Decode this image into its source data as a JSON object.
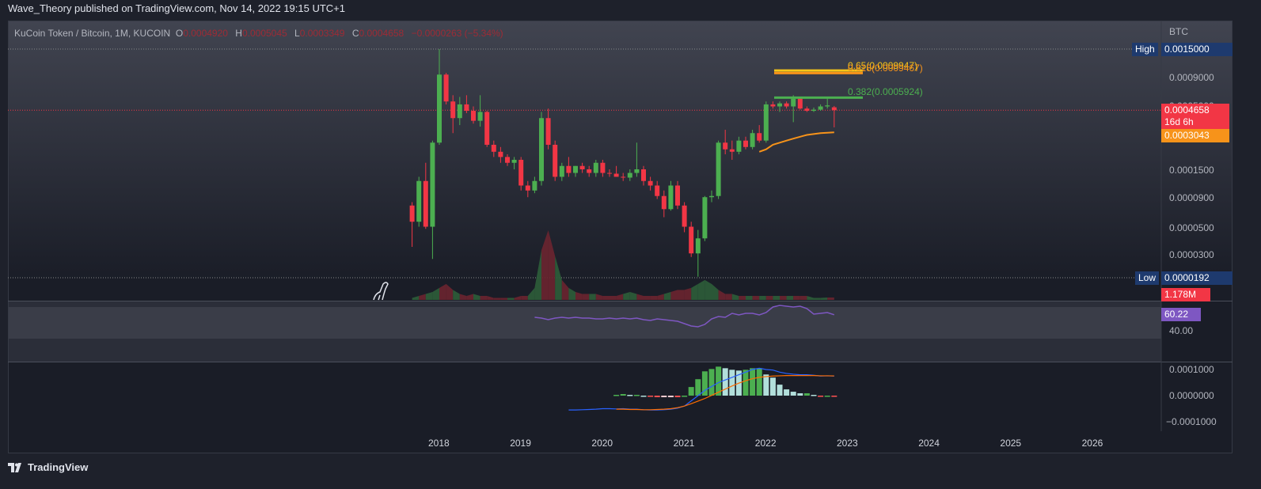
{
  "header": {
    "publisher_line": "Wave_Theory published on TradingView.com, Nov 14, 2022 19:15 UTC+1"
  },
  "legend": {
    "symbol": "KuCoin Token / Bitcoin, 1M, KUCOIN",
    "o_label": "O",
    "o": "0.0004920",
    "h_label": "H",
    "h": "0.0005045",
    "l_label": "L",
    "l": "0.0003349",
    "c_label": "C",
    "c": "0.0004658",
    "change": "−0.0000263 (−5.34%)"
  },
  "price_axis": {
    "currency": "BTC",
    "ticks": [
      "0.0009000",
      "0.0005000",
      "0.0001500",
      "0.0000900",
      "0.0000500",
      "0.0000300"
    ],
    "high_label": "High",
    "high_value": "0.0015000",
    "low_label": "Low",
    "low_value": "0.0000192",
    "last_price": "0.0004658",
    "countdown": "16d 6h",
    "ema_value": "0.0003043",
    "volume_value": "1.178M"
  },
  "rsi": {
    "value_label": "60.22",
    "tick": "40.00"
  },
  "macd": {
    "ticks": [
      "0.0001000",
      "0.0000000",
      "−0.0001000"
    ]
  },
  "time_axis": {
    "ticks": [
      "2018",
      "2019",
      "2020",
      "2021",
      "2022",
      "2023",
      "2024",
      "2025",
      "2026"
    ]
  },
  "fib": [
    {
      "label": "0.65(0.0009947)",
      "price": 0.0009947,
      "color": "#f5c518"
    },
    {
      "label": "0.618(0.0009467)",
      "price": 0.0009467,
      "color": "#f7931a"
    },
    {
      "label": "0.382(0.0005924)",
      "price": 0.0005924,
      "color": "#4caf50"
    }
  ],
  "footer": {
    "brand": "TradingView"
  },
  "colors": {
    "up": "#4caf50",
    "down": "#f23645",
    "ema": "#f7931a",
    "rsi": "#7e57c2",
    "macd": "#2962ff",
    "signal": "#ff6d00"
  },
  "chart_data": {
    "type": "candlestick",
    "title": "KuCoin Token / Bitcoin, 1M, KUCOIN",
    "scale": "log",
    "ylim": [
      1.92e-05,
      0.0015
    ],
    "start": "2017-09",
    "interval": "1M",
    "ohlc": [
      [
        7.5e-05,
        8e-05,
        3.4e-05,
        5.5e-05
      ],
      [
        5.5e-05,
        0.00013,
        5e-05,
        0.00012
      ],
      [
        0.00012,
        0.00017,
        4.8e-05,
        5e-05
      ],
      [
        5e-05,
        0.00026,
        2.7e-05,
        0.00025
      ],
      [
        0.00025,
        0.0015,
        0.00024,
        0.00092
      ],
      [
        0.00092,
        0.00095,
        0.00052,
        0.00055
      ],
      [
        0.00055,
        0.00062,
        0.0003,
        0.0004
      ],
      [
        0.0004,
        0.0006,
        0.00035,
        0.00052
      ],
      [
        0.00052,
        0.00062,
        0.00044,
        0.00046
      ],
      [
        0.00046,
        0.0005,
        0.00036,
        0.00038
      ],
      [
        0.00038,
        0.00062,
        0.00034,
        0.00045
      ],
      [
        0.00045,
        0.00046,
        0.00023,
        0.00024
      ],
      [
        0.00024,
        0.00026,
        0.00019,
        0.00021
      ],
      [
        0.00021,
        0.00023,
        0.00017,
        0.00019
      ],
      [
        0.00019,
        0.0002,
        0.00016,
        0.00017
      ],
      [
        0.00017,
        0.00019,
        0.00015,
        0.00018
      ],
      [
        0.00018,
        0.00019,
        0.0001,
        0.00011
      ],
      [
        0.00011,
        0.00012,
        8.8e-05,
        0.0001
      ],
      [
        0.0001,
        0.00013,
        9.5e-05,
        0.00012
      ],
      [
        0.00012,
        0.00045,
        0.00011,
        0.0004
      ],
      [
        0.0004,
        0.00048,
        0.00022,
        0.00024
      ],
      [
        0.00024,
        0.00026,
        0.00012,
        0.00013
      ],
      [
        0.00013,
        0.00017,
        0.00012,
        0.00016
      ],
      [
        0.00016,
        0.00019,
        0.00013,
        0.00014
      ],
      [
        0.00014,
        0.00016,
        0.00013,
        0.00016
      ],
      [
        0.00016,
        0.00017,
        0.00014,
        0.00015
      ],
      [
        0.00015,
        0.00016,
        0.00013,
        0.00014
      ],
      [
        0.00014,
        0.00018,
        0.00013,
        0.00017
      ],
      [
        0.00017,
        0.00018,
        0.00013,
        0.00014
      ],
      [
        0.00014,
        0.00015,
        0.00013,
        0.000138
      ],
      [
        0.000138,
        0.00016,
        0.00013,
        0.00013
      ],
      [
        0.00013,
        0.00014,
        0.00012,
        0.000128
      ],
      [
        0.000128,
        0.00015,
        0.00012,
        0.00014
      ],
      [
        0.00014,
        0.00025,
        0.00013,
        0.00015
      ],
      [
        0.00015,
        0.00016,
        0.00011,
        0.00012
      ],
      [
        0.00012,
        0.00013,
        0.0001,
        0.00011
      ],
      [
        0.00011,
        0.00012,
        8.5e-05,
        9e-05
      ],
      [
        9e-05,
        0.0001,
        6e-05,
        7e-05
      ],
      [
        7e-05,
        0.00012,
        6.8e-05,
        0.00011
      ],
      [
        0.00011,
        0.00012,
        7e-05,
        7.5e-05
      ],
      [
        7.5e-05,
        8e-05,
        4.5e-05,
        5e-05
      ],
      [
        5e-05,
        5.5e-05,
        2.8e-05,
        3e-05
      ],
      [
        3e-05,
        4.7e-05,
        1.92e-05,
        4e-05
      ],
      [
        4e-05,
        9e-05,
        3.8e-05,
        8.8e-05
      ],
      [
        8.8e-05,
        0.0001,
        8e-05,
        9e-05
      ],
      [
        9e-05,
        0.00026,
        8.5e-05,
        0.00025
      ],
      [
        0.00025,
        0.00032,
        0.0002,
        0.00022
      ],
      [
        0.00022,
        0.00026,
        0.00018,
        0.00021
      ],
      [
        0.00021,
        0.00028,
        0.0002,
        0.00026
      ],
      [
        0.00026,
        0.00028,
        0.00022,
        0.00023
      ],
      [
        0.00023,
        0.00032,
        0.00022,
        0.0003
      ],
      [
        0.0003,
        0.00035,
        0.00025,
        0.00026
      ],
      [
        0.00026,
        0.00055,
        0.00025,
        0.00052
      ],
      [
        0.00052,
        0.00055,
        0.00048,
        0.0005
      ],
      [
        0.0005,
        0.00055,
        0.00045,
        0.00053
      ],
      [
        0.00053,
        0.00055,
        0.00048,
        0.0005
      ],
      [
        0.0005,
        0.00062,
        0.00037,
        0.00058
      ],
      [
        0.00058,
        0.0006,
        0.00047,
        0.00048
      ],
      [
        0.00048,
        0.0005,
        0.00045,
        0.00046
      ],
      [
        0.00046,
        0.00049,
        0.00045,
        0.00047
      ],
      [
        0.00047,
        0.00052,
        0.00046,
        0.0005
      ],
      [
        0.0005,
        0.00058,
        0.00048,
        0.00051
      ],
      [
        0.000492,
        0.0005045,
        0.0003349,
        0.0004658
      ]
    ],
    "ema": {
      "start_index": 51,
      "values": [
        0.00021,
        0.00022,
        0.00024,
        0.00025,
        0.00026,
        0.00027,
        0.00028,
        0.00029,
        0.000295,
        0.0003,
        0.000302,
        0.0003043
      ]
    },
    "volume_M": [
      1,
      2,
      3,
      4,
      6,
      8,
      5,
      3,
      2,
      3,
      2,
      2,
      1,
      1,
      1,
      1,
      2,
      2,
      6,
      25,
      35,
      22,
      10,
      6,
      4,
      3,
      3,
      3,
      2,
      2,
      2,
      3,
      4,
      3,
      2,
      2,
      2,
      3,
      4,
      5,
      5,
      6,
      8,
      10,
      8,
      5,
      3,
      3,
      2,
      2,
      2,
      2,
      2,
      2,
      2,
      2,
      2,
      2,
      2,
      1,
      1,
      1.2,
      1.178
    ],
    "rsi": {
      "start_index": 18,
      "values": [
        57,
        56,
        54,
        56,
        57,
        56,
        57,
        56,
        56,
        55,
        55,
        56,
        55,
        56,
        55,
        56,
        54,
        53,
        55,
        54,
        53,
        52,
        49,
        46,
        45,
        48,
        55,
        58,
        57,
        62,
        60,
        62,
        62,
        60,
        63,
        70,
        72,
        71,
        70,
        71,
        68,
        61,
        62,
        63,
        60.22
      ]
    },
    "macd": {
      "start_index": 23,
      "macd": [
        -5.5e-05,
        -5.5e-05,
        -5.4e-05,
        -5.3e-05,
        -5.2e-05,
        -5e-05,
        -5e-05,
        -5.1e-05,
        -5e-05,
        -5.2e-05,
        -5.2e-05,
        -5.4e-05,
        -5.5e-05,
        -5.5e-05,
        -5.4e-05,
        -5.2e-05,
        -4.8e-05,
        -4e-05,
        -2e-05,
        0,
        2e-05,
        3.5e-05,
        5e-05,
        6e-05,
        7e-05,
        8e-05,
        9e-05,
        0.0001,
        0.000105,
        0.0001,
        9.8e-05,
        9e-05,
        8.5e-05,
        8.2e-05,
        8e-05,
        8e-05,
        7.8e-05,
        7.5e-05,
        7.6e-05,
        7.5e-05
      ],
      "signal_start_index": 30,
      "signal": [
        -5.2e-05,
        -5.2e-05,
        -5.3e-05,
        -5.3e-05,
        -5.4e-05,
        -5.4e-05,
        -5.3e-05,
        -5.2e-05,
        -5e-05,
        -4.6e-05,
        -4e-05,
        -3.1e-05,
        -2.1e-05,
        -1.1e-05,
        1e-06,
        1.3e-05,
        2.5e-05,
        3.7e-05,
        4.8e-05,
        5.7e-05,
        6.5e-05,
        7e-05,
        7.3e-05,
        7.5e-05,
        7.6e-05,
        7.7e-05,
        7.7e-05,
        7.7e-05,
        7.7e-05,
        7.7e-05,
        7.6e-05,
        7.6e-05,
        7.55e-05
      ]
    }
  }
}
